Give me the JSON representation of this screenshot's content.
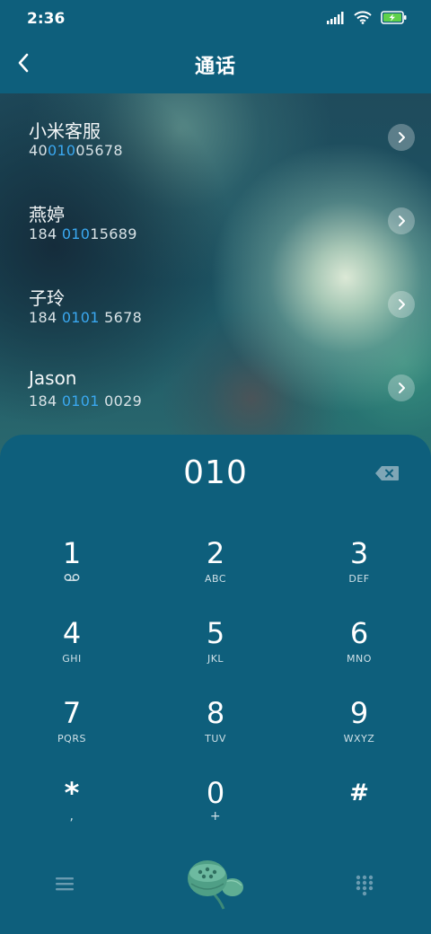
{
  "status": {
    "time": "2:36"
  },
  "header": {
    "title": "通话"
  },
  "contacts": [
    {
      "name": "小米客服",
      "num_pre": "40",
      "num_hl": "010",
      "num_post": "05678"
    },
    {
      "name": "燕婷",
      "num_pre": "184 ",
      "num_hl": "010",
      "num_post": "15689"
    },
    {
      "name": "子玲",
      "num_pre": "184 ",
      "num_hl": "0101",
      "num_post": " 5678"
    },
    {
      "name": "Jason",
      "num_pre": "184 ",
      "num_hl": "0101",
      "num_post": " 0029"
    }
  ],
  "dialer": {
    "input": "010",
    "keys": [
      {
        "digit": "1",
        "letters": "voicemail"
      },
      {
        "digit": "2",
        "letters": "ABC"
      },
      {
        "digit": "3",
        "letters": "DEF"
      },
      {
        "digit": "4",
        "letters": "GHI"
      },
      {
        "digit": "5",
        "letters": "JKL"
      },
      {
        "digit": "6",
        "letters": "MNO"
      },
      {
        "digit": "7",
        "letters": "PQRS"
      },
      {
        "digit": "8",
        "letters": "TUV"
      },
      {
        "digit": "9",
        "letters": "WXYZ"
      },
      {
        "digit": "*",
        "letters": ","
      },
      {
        "digit": "0",
        "letters": "+"
      },
      {
        "digit": "#",
        "letters": ""
      }
    ]
  },
  "icons": {
    "menu": "menu-icon",
    "call": "lotus-call-icon",
    "keypad": "keypad-icon",
    "backspace": "backspace-icon"
  },
  "colors": {
    "accent": "#3aa8f0",
    "panel": "#0e5f7c"
  }
}
